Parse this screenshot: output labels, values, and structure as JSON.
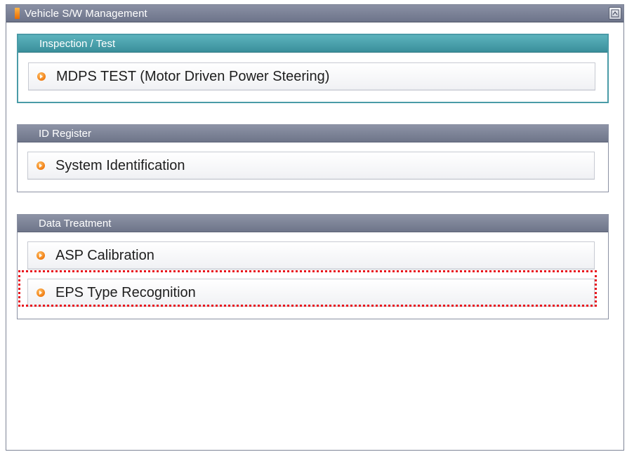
{
  "window": {
    "title": "Vehicle S/W Management",
    "title_button_icon": "window-restore-icon"
  },
  "groups": [
    {
      "header": "Inspection / Test",
      "items": [
        {
          "label": "MDPS TEST (Motor Driven Power Steering)",
          "icon": "orange-arrow-bullet-icon"
        }
      ]
    },
    {
      "header": "ID Register",
      "items": [
        {
          "label": "System Identification",
          "icon": "orange-arrow-bullet-icon"
        }
      ]
    },
    {
      "header": "Data Treatment",
      "items": [
        {
          "label": "ASP Calibration",
          "icon": "orange-arrow-bullet-icon"
        },
        {
          "label": "EPS Type Recognition",
          "icon": "orange-arrow-bullet-icon",
          "highlighted": true
        }
      ]
    }
  ],
  "colors": {
    "header_teal": "#4a9ba7",
    "header_gray": "#7a8095",
    "highlight_dotted_border": "#e8141c",
    "bullet_orange": "#f07b10"
  }
}
